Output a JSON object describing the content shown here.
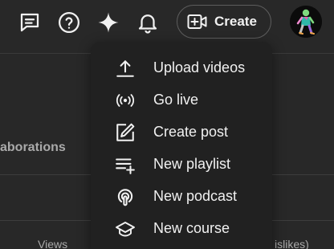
{
  "header": {
    "create_label": "Create"
  },
  "background": {
    "section_fragment": "aborations",
    "col_views": "Views",
    "col_dislikes": "islikes)"
  },
  "create_menu": {
    "items": [
      {
        "label": "Upload videos",
        "icon": "upload-icon"
      },
      {
        "label": "Go live",
        "icon": "live-broadcast-icon"
      },
      {
        "label": "Create post",
        "icon": "edit-post-icon"
      },
      {
        "label": "New playlist",
        "icon": "add-playlist-icon"
      },
      {
        "label": "New podcast",
        "icon": "podcast-icon"
      },
      {
        "label": "New course",
        "icon": "course-cap-icon"
      }
    ]
  },
  "colors": {
    "background": "#282828",
    "menu_background": "#212121",
    "text": "#f1f1f1",
    "muted_text": "#aaaaaa"
  }
}
